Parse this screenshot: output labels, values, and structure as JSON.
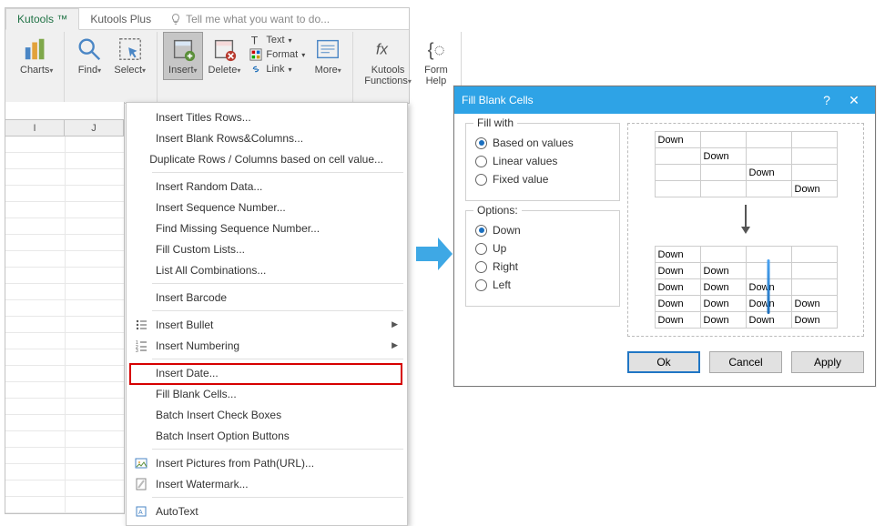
{
  "tabs": {
    "active": "Kutools ™",
    "other": "Kutools Plus",
    "tellme": "Tell me what you want to do..."
  },
  "ribbon": {
    "charts": "Charts",
    "find": "Find",
    "select": "Select",
    "insert": "Insert",
    "delete": "Delete",
    "text": "Text",
    "format": "Format",
    "link": "Link",
    "more": "More",
    "functions": "Kutools\nFunctions",
    "formhelp": "Form\nHelp"
  },
  "menu": [
    "Insert Titles Rows...",
    "Insert Blank Rows&Columns...",
    "Duplicate Rows / Columns based on cell value...",
    "Insert Random Data...",
    "Insert Sequence Number...",
    "Find Missing Sequence Number...",
    "Fill Custom Lists...",
    "List All Combinations...",
    "Insert Barcode",
    "Insert Bullet",
    "Insert Numbering",
    "Insert Date...",
    "Fill Blank Cells...",
    "Batch Insert Check Boxes",
    "Batch Insert Option Buttons",
    "Insert Pictures from Path(URL)...",
    "Insert Watermark...",
    "AutoText"
  ],
  "sheet": {
    "colI": "I",
    "colJ": "J"
  },
  "dialog": {
    "title": "Fill Blank Cells",
    "help": "?",
    "close": "✕",
    "fillwith_legend": "Fill with",
    "fillwith": {
      "based": "Based on values",
      "linear": "Linear values",
      "fixed": "Fixed value"
    },
    "options_legend": "Options:",
    "options": {
      "down": "Down",
      "up": "Up",
      "right": "Right",
      "left": "Left"
    },
    "cell": "Down",
    "ok": "Ok",
    "cancel": "Cancel",
    "apply": "Apply"
  }
}
